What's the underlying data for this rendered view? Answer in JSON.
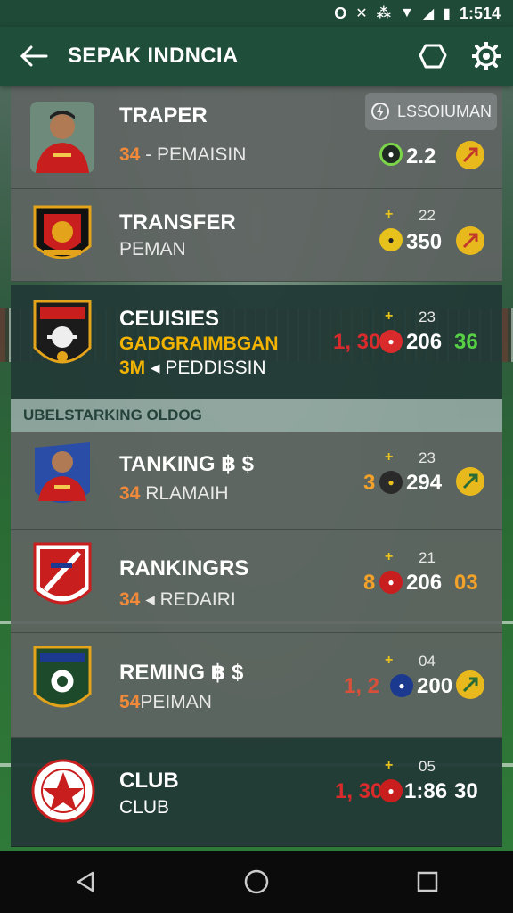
{
  "status": {
    "left_icon": "O",
    "time": "1:514"
  },
  "appbar": {
    "title": "SEPAK INDNCIA"
  },
  "pill": {
    "label": "LSSOIUMAN"
  },
  "section": {
    "label": "UBELSTARKING OLDOG"
  },
  "cards": [
    {
      "name": "TRAPER",
      "num": "34",
      "sub": "- PEMAISIN",
      "small": "",
      "value": "2.2",
      "pre": "",
      "post": ""
    },
    {
      "name": "TRANSFER",
      "sub": "PEMAN",
      "small": "22",
      "value": "350",
      "pre": "",
      "post": ""
    },
    {
      "name": "CEUISIES",
      "sub_gold": "GADGRAIMBGAN",
      "sub_line3_num": "3M",
      "sub_line3": "PEDDISSIN",
      "small": "23",
      "value": "206",
      "pre": "1, 30",
      "post": "36"
    },
    {
      "name": "TANKING ฿ $",
      "num": "34",
      "sub": "RLAMAIH",
      "small": "23",
      "value": "294",
      "pre": "3",
      "post": ""
    },
    {
      "name": "RANKINGRS",
      "num": "34",
      "sub": "REDAIRI",
      "small": "21",
      "value": "206",
      "pre": "8",
      "post": "03"
    },
    {
      "name": "REMING ฿ $",
      "num": "54",
      "sub": "PEIMAN",
      "small": "04",
      "value": "200",
      "pre": "1, 2",
      "post": ""
    },
    {
      "name": "CLUB",
      "sub": "CLUB",
      "small": "05",
      "value": "1:86",
      "pre": "1, 30",
      "post": "30"
    }
  ],
  "colors": {
    "appbar": "#1f4f3b",
    "accent": "#e8b91c",
    "pre_red": "#d92b2b",
    "post_green": "#57d046",
    "post_orange": "#f2a12a"
  }
}
